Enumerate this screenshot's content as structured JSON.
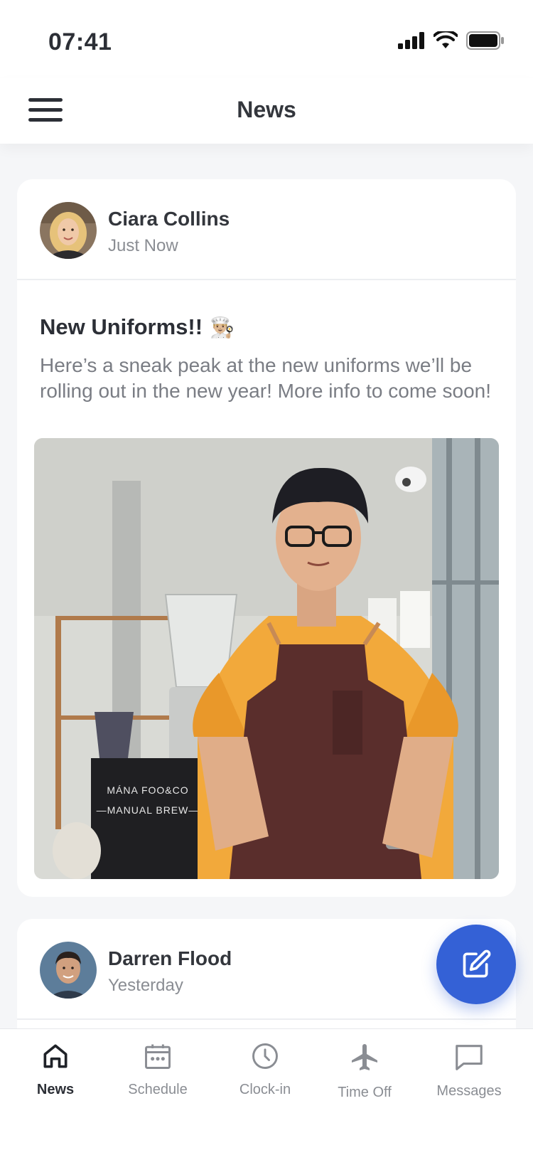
{
  "status_bar": {
    "time": "07:41"
  },
  "header": {
    "title": "News"
  },
  "posts": [
    {
      "author": "Ciara Collins",
      "time": "Just Now",
      "title": "New Uniforms!!",
      "title_emoji": "👨🏼‍🍳",
      "body": "Here’s a sneak peak at the new uniforms we’ll be rolling out in the new year! More info to come soon!",
      "image_sign_line1": "MÁNA FOO&CO",
      "image_sign_line2": "—MANUAL BREW—"
    },
    {
      "author": "Darren Flood",
      "time": "Yesterday"
    }
  ],
  "bottom_nav": [
    {
      "label": "News",
      "icon": "home-icon",
      "active": true
    },
    {
      "label": "Schedule",
      "icon": "calendar-icon",
      "active": false
    },
    {
      "label": "Clock-in",
      "icon": "clock-icon",
      "active": false
    },
    {
      "label": "Time Off",
      "icon": "airplane-icon",
      "active": false
    },
    {
      "label": "Messages",
      "icon": "chat-icon",
      "active": false
    }
  ],
  "colors": {
    "accent": "#3461d6",
    "background": "#f5f6f8",
    "text": "#2c2f36",
    "muted": "#8a8d93"
  }
}
